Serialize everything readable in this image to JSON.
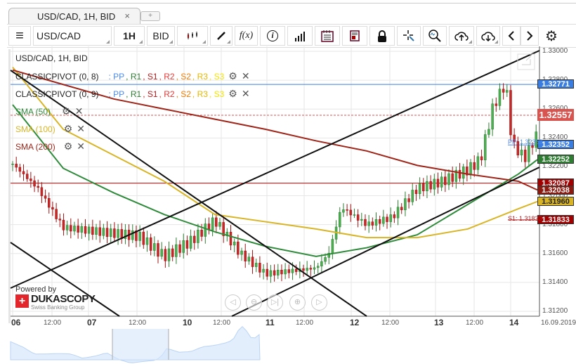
{
  "tab": {
    "title": "USD/CAD, 1H, BID",
    "close": "×",
    "add": "+"
  },
  "toolbar": {
    "menu": "≡",
    "symbol": "USD/CAD",
    "period": "1H",
    "side": "BID",
    "fx": "f(x)",
    "info": "i"
  },
  "chart": {
    "title": "USD/CAD, 1H, BID",
    "pivots": [
      {
        "name": "CLASSICPIVOT (0, 8)"
      },
      {
        "name": "CLASSICPIVOT (0, 9)"
      }
    ],
    "pivot_levels": [
      ": PP",
      ", R1",
      ", S1",
      ", R2",
      ", S2",
      ", R3",
      ", S3"
    ],
    "smas": [
      {
        "name": "SMA (50)",
        "color": "#2e8b3a"
      },
      {
        "name": "SMA (100)",
        "color": "#d9b526"
      },
      {
        "name": "SMA (200)",
        "color": "#a02418"
      }
    ],
    "price_labels": [
      {
        "text": "1.32771",
        "price": 1.32771,
        "bg": "#3a7de0"
      },
      {
        "text": "1.32557",
        "price": 1.32557,
        "bg": "#d9534f"
      },
      {
        "text": "1.32352",
        "price": 1.32352,
        "bg": "#3a7de0"
      },
      {
        "text": "1.32252",
        "price": 1.32252,
        "bg": "#2e7d32"
      },
      {
        "text": "1.32087",
        "price": 1.32087,
        "bg": "#a00000"
      },
      {
        "text": "1.32038",
        "price": 1.32038,
        "bg": "#8b1a10"
      },
      {
        "text": "1.31960",
        "price": 1.3196,
        "bg": "#d9b526"
      },
      {
        "text": "1.31833",
        "price": 1.31833,
        "bg": "#a00000"
      }
    ],
    "pp_text": "PP: 1.32352",
    "s1_text": "S1: 1.31833",
    "y_ticks": [
      "1.33000",
      "1.32800",
      "1.32600",
      "1.32400",
      "1.32200",
      "1.32000",
      "1.31800",
      "1.31600",
      "1.31400",
      "1.31200"
    ],
    "x_ticks": [
      {
        "t": "06",
        "big": true
      },
      {
        "t": "12:00"
      },
      {
        "t": "07",
        "big": true
      },
      {
        "t": "12:00"
      },
      {
        "t": "10",
        "big": true
      },
      {
        "t": "12:00"
      },
      {
        "t": "11",
        "big": true
      },
      {
        "t": "12:00"
      },
      {
        "t": "12",
        "big": true
      },
      {
        "t": "12:00"
      },
      {
        "t": "13",
        "big": true
      },
      {
        "t": "12:00"
      },
      {
        "t": "14",
        "big": true
      },
      {
        "t": "16.09.2019"
      }
    ],
    "logo": {
      "powered": "Powered by",
      "brand": "DUKASCOPY",
      "sub": "Swiss Banking Group"
    }
  },
  "chart_data": {
    "type": "candlestick",
    "ylim": [
      1.312,
      1.3305
    ],
    "price_path": [
      [
        0,
        1.3222
      ],
      [
        8,
        1.3205
      ],
      [
        16,
        1.3178
      ],
      [
        24,
        1.3176
      ],
      [
        32,
        1.3174
      ],
      [
        40,
        1.3172
      ],
      [
        48,
        1.3158
      ],
      [
        56,
        1.3168
      ],
      [
        64,
        1.3183
      ],
      [
        72,
        1.316
      ],
      [
        80,
        1.3146
      ],
      [
        88,
        1.3148
      ],
      [
        96,
        1.315
      ],
      [
        100,
        1.316
      ],
      [
        104,
        1.3192
      ],
      [
        112,
        1.318
      ],
      [
        120,
        1.3185
      ],
      [
        128,
        1.3205
      ],
      [
        136,
        1.321
      ],
      [
        144,
        1.3218
      ],
      [
        148,
        1.3225
      ],
      [
        152,
        1.3262
      ],
      [
        156,
        1.3278
      ],
      [
        158,
        1.3236
      ],
      [
        162,
        1.3226
      ],
      [
        166,
        1.3243
      ]
    ],
    "sma50": [
      [
        0,
        1.3263
      ],
      [
        16,
        1.3219
      ],
      [
        32,
        1.3202
      ],
      [
        48,
        1.3187
      ],
      [
        64,
        1.3175
      ],
      [
        80,
        1.3165
      ],
      [
        96,
        1.3158
      ],
      [
        112,
        1.3164
      ],
      [
        128,
        1.3173
      ],
      [
        144,
        1.3194
      ],
      [
        160,
        1.3215
      ],
      [
        166,
        1.3225
      ]
    ],
    "sma100": [
      [
        0,
        1.3289
      ],
      [
        16,
        1.3246
      ],
      [
        32,
        1.3228
      ],
      [
        48,
        1.321
      ],
      [
        64,
        1.3187
      ],
      [
        80,
        1.3182
      ],
      [
        96,
        1.3177
      ],
      [
        112,
        1.3171
      ],
      [
        128,
        1.3171
      ],
      [
        144,
        1.3177
      ],
      [
        160,
        1.3191
      ],
      [
        166,
        1.3196
      ]
    ],
    "sma200": [
      [
        0,
        1.3287
      ],
      [
        16,
        1.3277
      ],
      [
        32,
        1.3267
      ],
      [
        48,
        1.326
      ],
      [
        64,
        1.3253
      ],
      [
        80,
        1.3246
      ],
      [
        96,
        1.3238
      ],
      [
        112,
        1.3231
      ],
      [
        128,
        1.3221
      ],
      [
        144,
        1.3215
      ],
      [
        160,
        1.321
      ],
      [
        166,
        1.3204
      ]
    ]
  }
}
